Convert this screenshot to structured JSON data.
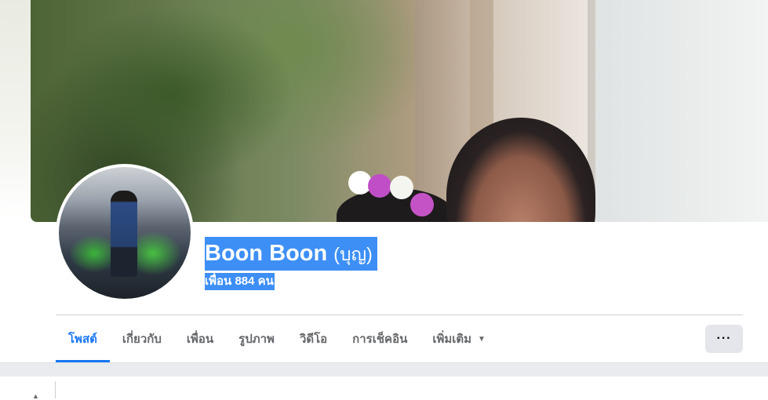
{
  "profile": {
    "name": "Boon Boon",
    "alternate_name": "(บุญ)",
    "friends_label": "เพื่อน 884 คน"
  },
  "tabs": [
    {
      "label": "โพสต์",
      "active": true
    },
    {
      "label": "เกี่ยวกับ",
      "active": false
    },
    {
      "label": "เพื่อน",
      "active": false
    },
    {
      "label": "รูปภาพ",
      "active": false
    },
    {
      "label": "วิดีโอ",
      "active": false
    },
    {
      "label": "การเช็คอิน",
      "active": false
    },
    {
      "label": "เพิ่มเติม",
      "active": false
    }
  ],
  "more_button": "···",
  "colors": {
    "accent": "#1877f2",
    "selection": "#3d8ff5",
    "tab_text": "#65676b",
    "button_bg": "#e4e6eb"
  },
  "icons": {
    "more_caret": "caret-down-icon",
    "more_options": "ellipsis-icon"
  }
}
